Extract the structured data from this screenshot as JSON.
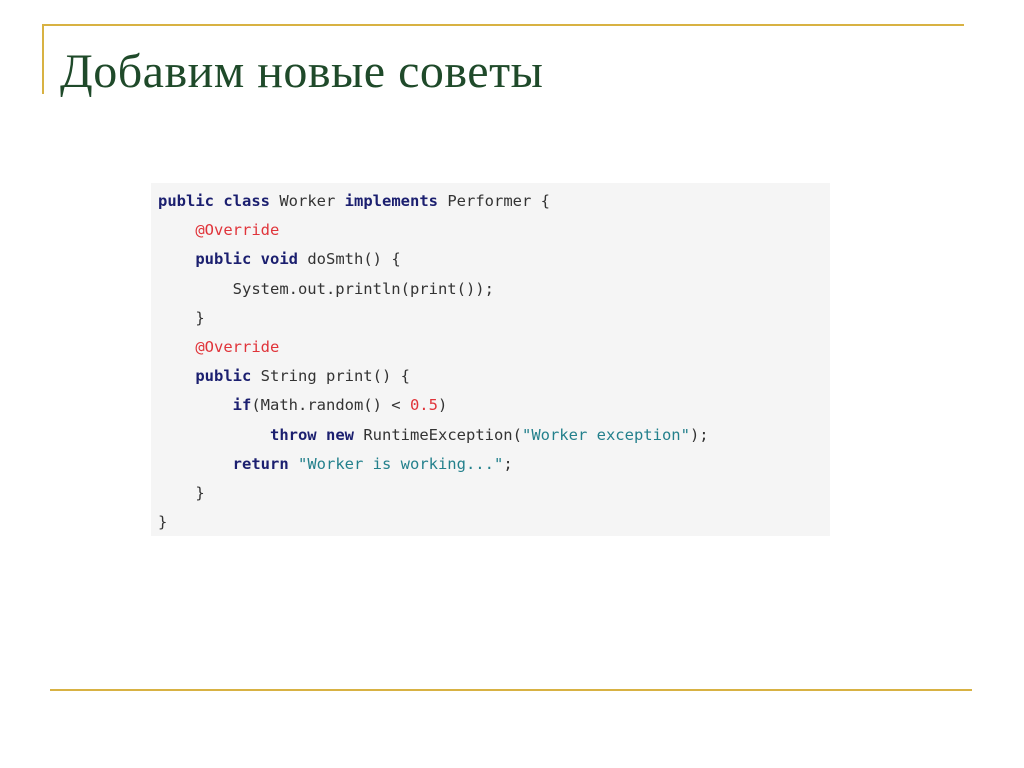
{
  "slide": {
    "title": "Добавим новые советы"
  },
  "code": {
    "language": "java",
    "lines": [
      {
        "indent": 0,
        "tokens": [
          {
            "t": "public",
            "k": "kw"
          },
          {
            "t": " ",
            "k": "txt"
          },
          {
            "t": "class",
            "k": "kw"
          },
          {
            "t": " Worker ",
            "k": "txt"
          },
          {
            "t": "implements",
            "k": "kw"
          },
          {
            "t": " Performer {",
            "k": "txt"
          }
        ]
      },
      {
        "indent": 1,
        "tokens": [
          {
            "t": "@Override",
            "k": "ann"
          }
        ]
      },
      {
        "indent": 1,
        "tokens": [
          {
            "t": "public",
            "k": "kw"
          },
          {
            "t": " ",
            "k": "txt"
          },
          {
            "t": "void",
            "k": "kw"
          },
          {
            "t": " doSmth() {",
            "k": "txt"
          }
        ]
      },
      {
        "indent": 2,
        "tokens": [
          {
            "t": "System.out.println(print());",
            "k": "txt"
          }
        ]
      },
      {
        "indent": 1,
        "tokens": [
          {
            "t": "}",
            "k": "txt"
          }
        ]
      },
      {
        "indent": 1,
        "tokens": [
          {
            "t": "@Override",
            "k": "ann"
          }
        ]
      },
      {
        "indent": 1,
        "tokens": [
          {
            "t": "public",
            "k": "kw"
          },
          {
            "t": " String print() {",
            "k": "txt"
          }
        ]
      },
      {
        "indent": 2,
        "tokens": [
          {
            "t": "if",
            "k": "kw"
          },
          {
            "t": "(Math.random() < ",
            "k": "txt"
          },
          {
            "t": "0.5",
            "k": "num"
          },
          {
            "t": ")",
            "k": "txt"
          }
        ]
      },
      {
        "indent": 3,
        "tokens": [
          {
            "t": "throw",
            "k": "kw"
          },
          {
            "t": " ",
            "k": "txt"
          },
          {
            "t": "new",
            "k": "kw"
          },
          {
            "t": " RuntimeException(",
            "k": "txt"
          },
          {
            "t": "\"Worker exception\"",
            "k": "str"
          },
          {
            "t": ");",
            "k": "txt"
          }
        ]
      },
      {
        "indent": 2,
        "tokens": [
          {
            "t": "return",
            "k": "kw"
          },
          {
            "t": " ",
            "k": "txt"
          },
          {
            "t": "\"Worker is working...\"",
            "k": "str"
          },
          {
            "t": ";",
            "k": "txt"
          }
        ]
      },
      {
        "indent": 1,
        "tokens": [
          {
            "t": "}",
            "k": "txt"
          }
        ]
      },
      {
        "indent": 0,
        "tokens": [
          {
            "t": "}",
            "k": "txt"
          }
        ]
      }
    ]
  },
  "colors": {
    "title": "#1f4a2a",
    "rule": "#d8b243",
    "code_background": "#f5f5f5",
    "keyword": "#1b1f6f",
    "annotation": "#e0343a",
    "number": "#e0343a",
    "string": "#23808c",
    "text": "#333333"
  }
}
